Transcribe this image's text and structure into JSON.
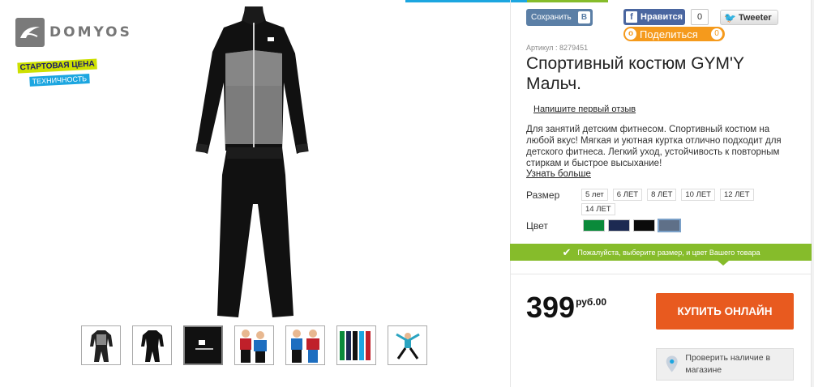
{
  "brand": {
    "logo_text": "DOMYOS",
    "badge_line1": "СТАРТОВАЯ ЦЕНА",
    "badge_line2": "ТЕХНИЧНОСТЬ"
  },
  "social": {
    "vk_label": "Сохранить",
    "vk_icon": "В",
    "fb_label": "Нравится",
    "fb_count": "0",
    "tw_label": "Tweeter",
    "ok_label": "Поделиться",
    "ok_count": "0"
  },
  "product": {
    "article": "Артикул : 8279451",
    "title": "Спортивный костюм GYM'Y Мальч.",
    "review_link": "Напишите первый отзыв",
    "description": "Для занятий детским фитнесом. Спортивный костюм на любой вкус! Мягкая и уютная куртка отлично подходит для детского фитнеса. Легкий уход, устойчивость к повторным стиркам и быстрое высыхание!",
    "more_link": "Узнать больше"
  },
  "options": {
    "size_label": "Размер",
    "sizes": [
      "5 лет",
      "6 ЛЕТ",
      "8 ЛЕТ",
      "10 ЛЕТ",
      "12 ЛЕТ",
      "14 ЛЕТ"
    ],
    "color_label": "Цвет",
    "colors": [
      "#0a8a3a",
      "#1c2a52",
      "#0b0b0b",
      "#5f7088"
    ]
  },
  "alert": {
    "text": "Пожалуйста, выберите размер, и цвет Вашего товара"
  },
  "purchase": {
    "price_main": "399",
    "price_currency": "руб.00",
    "buy_label": "КУПИТЬ ОНЛАЙН",
    "store_label": "Проверить наличие в магазине"
  },
  "thumbnails": [
    "front-view",
    "black-view",
    "logo-detail",
    "kids-red",
    "kids-blue",
    "color-range",
    "kid-jumping"
  ]
}
